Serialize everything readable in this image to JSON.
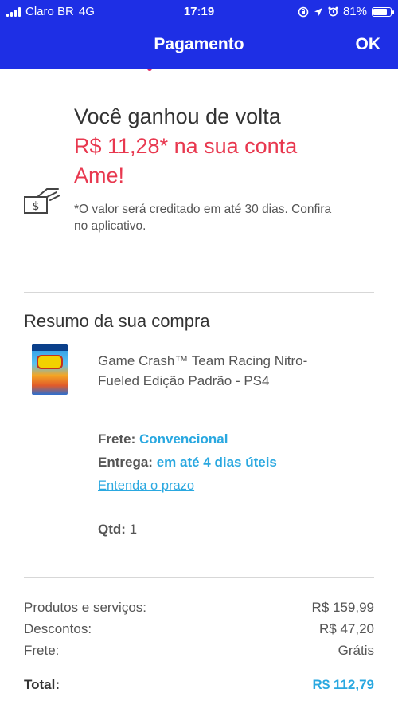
{
  "status_bar": {
    "carrier": "Claro BR",
    "network": "4G",
    "time": "17:19",
    "battery_percent": "81%",
    "battery_level": 0.81
  },
  "header": {
    "title": "Pagamento",
    "ok_label": "OK",
    "background_color": "#1e2fe5"
  },
  "cashback": {
    "line1": "Você ganhou de volta",
    "line2": "R$ 11,28* na sua conta",
    "line3": "Ame!",
    "highlight_color": "#e8384f",
    "note_line1": "*O valor será creditado em até 30 dias. Confira",
    "note_line2": "no aplicativo.",
    "icon": "money-hand-icon"
  },
  "summary": {
    "title": "Resumo da sua compra",
    "product_name_line1": "Game Crash™ Team Racing Nitro-",
    "product_name_line2": "Fueled Edição Padrão - PS4",
    "frete_label": "Frete:",
    "frete_value": "Convencional",
    "entrega_label": "Entrega:",
    "entrega_value": "em até 4 dias úteis",
    "prazo_link": "Entenda o prazo",
    "qtd_label": "Qtd:",
    "qtd_value": "1",
    "accent_color": "#2aa8e0"
  },
  "totals": {
    "rows": [
      {
        "label": "Produtos e serviços:",
        "value": "R$ 159,99"
      },
      {
        "label": "Descontos:",
        "value": "R$ 47,20"
      },
      {
        "label": "Frete:",
        "value": "Grátis"
      }
    ],
    "total_label": "Total:",
    "total_value": "R$ 112,79"
  }
}
